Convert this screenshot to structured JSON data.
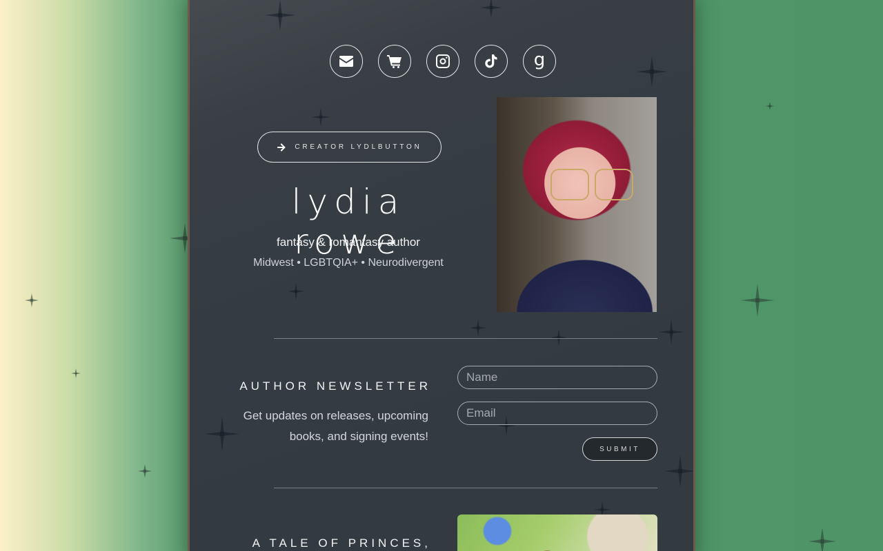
{
  "socials": [
    {
      "name": "email-icon",
      "label": "Email"
    },
    {
      "name": "shop-cart-icon",
      "label": "Shop"
    },
    {
      "name": "instagram-icon",
      "label": "Instagram"
    },
    {
      "name": "tiktok-icon",
      "label": "TikTok"
    },
    {
      "name": "goodreads-icon",
      "label": "g"
    }
  ],
  "profile": {
    "creator_button": "CREATOR LYDLBUTTON",
    "name": "lydia rowe",
    "tagline": "fantasy & romantasy author",
    "subline": "Midwest • LGBTQIA+ • Neurodivergent"
  },
  "newsletter": {
    "title": "AUTHOR NEWSLETTER",
    "description": "Get updates on releases, upcoming books, and signing events!",
    "name_placeholder": "Name",
    "email_placeholder": "Email",
    "submit_label": "SUBMIT"
  },
  "book_section": {
    "title": "A TALE OF PRINCES,"
  },
  "colors": {
    "card_bg": "#343b42",
    "card_border": "#6e5a4c",
    "page_bg_green": "#4d9466",
    "page_bg_cream": "#fdf0c8"
  }
}
